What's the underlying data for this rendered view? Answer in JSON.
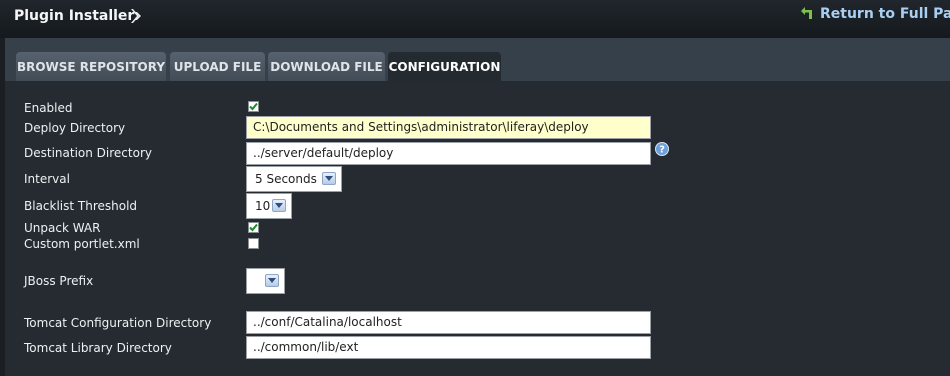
{
  "header": {
    "title": "Plugin Installer",
    "return_link": "Return to Full Page"
  },
  "tabs": [
    {
      "label": "BROWSE REPOSITORY"
    },
    {
      "label": "UPLOAD FILE"
    },
    {
      "label": "DOWNLOAD FILE"
    },
    {
      "label": "CONFIGURATION"
    }
  ],
  "form": {
    "enabled": {
      "label": "Enabled",
      "checked": true
    },
    "deploy_dir": {
      "label": "Deploy Directory",
      "value": "C:\\Documents and Settings\\administrator\\liferay\\deploy"
    },
    "dest_dir": {
      "label": "Destination Directory",
      "value": "../server/default/deploy"
    },
    "interval": {
      "label": "Interval",
      "value": "5 Seconds"
    },
    "blacklist": {
      "label": "Blacklist Threshold",
      "value": "10"
    },
    "unpack_war": {
      "label": "Unpack WAR",
      "checked": true
    },
    "custom_portlet": {
      "label": "Custom portlet.xml",
      "checked": false
    },
    "jboss_prefix": {
      "label": "JBoss Prefix",
      "value": ""
    },
    "tomcat_conf": {
      "label": "Tomcat Configuration Directory",
      "value": "../conf/Catalina/localhost"
    },
    "tomcat_lib": {
      "label": "Tomcat Library Directory",
      "value": "../common/lib/ext"
    }
  },
  "colors": {
    "accent_link": "#a9cff2",
    "highlight_field": "#ffffcc",
    "check_green": "#1e8a2a"
  },
  "icons": [
    "title-menu-arrow-icon",
    "return-arrow-icon",
    "help-icon",
    "checkmark-icon",
    "dropdown-arrow-icon"
  ]
}
